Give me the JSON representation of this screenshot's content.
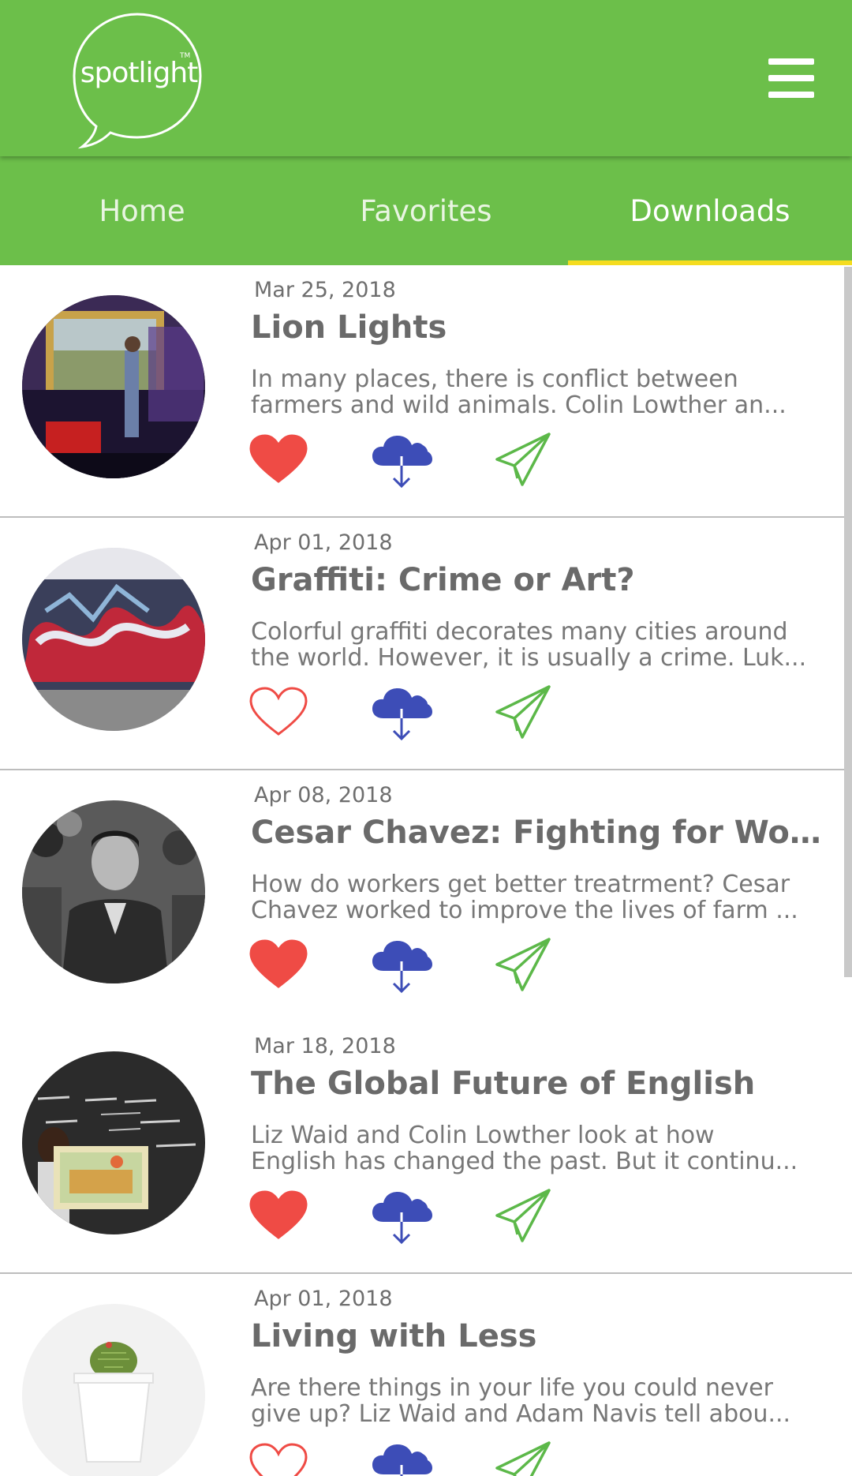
{
  "header": {
    "logo_text": "spotlight",
    "logo_tm": "TM",
    "menu_icon": "hamburger-menu-icon",
    "background_color": "#6cbf4a"
  },
  "tabs": [
    {
      "label": "Home",
      "active": false
    },
    {
      "label": "Favorites",
      "active": false
    },
    {
      "label": "Downloads",
      "active": true
    }
  ],
  "tab_indicator_color": "#f5dc1f",
  "colors": {
    "like": "#ef4b45",
    "download": "#3d4db7",
    "share": "#5cb849"
  },
  "items": [
    {
      "date": "Mar 25, 2018",
      "title": "Lion Lights",
      "desc_line1": "In many places, there is conflict between",
      "desc_line2": "farmers and wild animals. Colin Lowther an...",
      "liked": true,
      "image": "ted-talk-speaker-photo"
    },
    {
      "date": "Apr 01, 2018",
      "title": "Graffiti: Crime or Art?",
      "desc_line1": "Colorful graffiti decorates many cities around",
      "desc_line2": "the world. However, it is usually a crime. Luk...",
      "liked": false,
      "image": "graffiti-wall-photo"
    },
    {
      "date": "Apr 08, 2018",
      "title": "Cesar Chavez: Fighting for Worke...",
      "desc_line1": "How do workers get better treatrment? Cesar",
      "desc_line2": "Chavez worked to improve the lives of farm ...",
      "liked": true,
      "image": "cesar-chavez-photo"
    },
    {
      "date": "Mar 18, 2018",
      "title": "The Global Future of English",
      "desc_line1": "Liz Waid and Colin Lowther look at how",
      "desc_line2": "English has changed the past. But it continu...",
      "liked": true,
      "image": "classroom-blackboard-photo"
    },
    {
      "date": "Apr 01, 2018",
      "title": "Living with Less",
      "desc_line1": "Are there things in your life you could never",
      "desc_line2": "give up? Liz Waid and Adam Navis tell abou...",
      "liked": false,
      "image": "cactus-pot-photo"
    }
  ]
}
